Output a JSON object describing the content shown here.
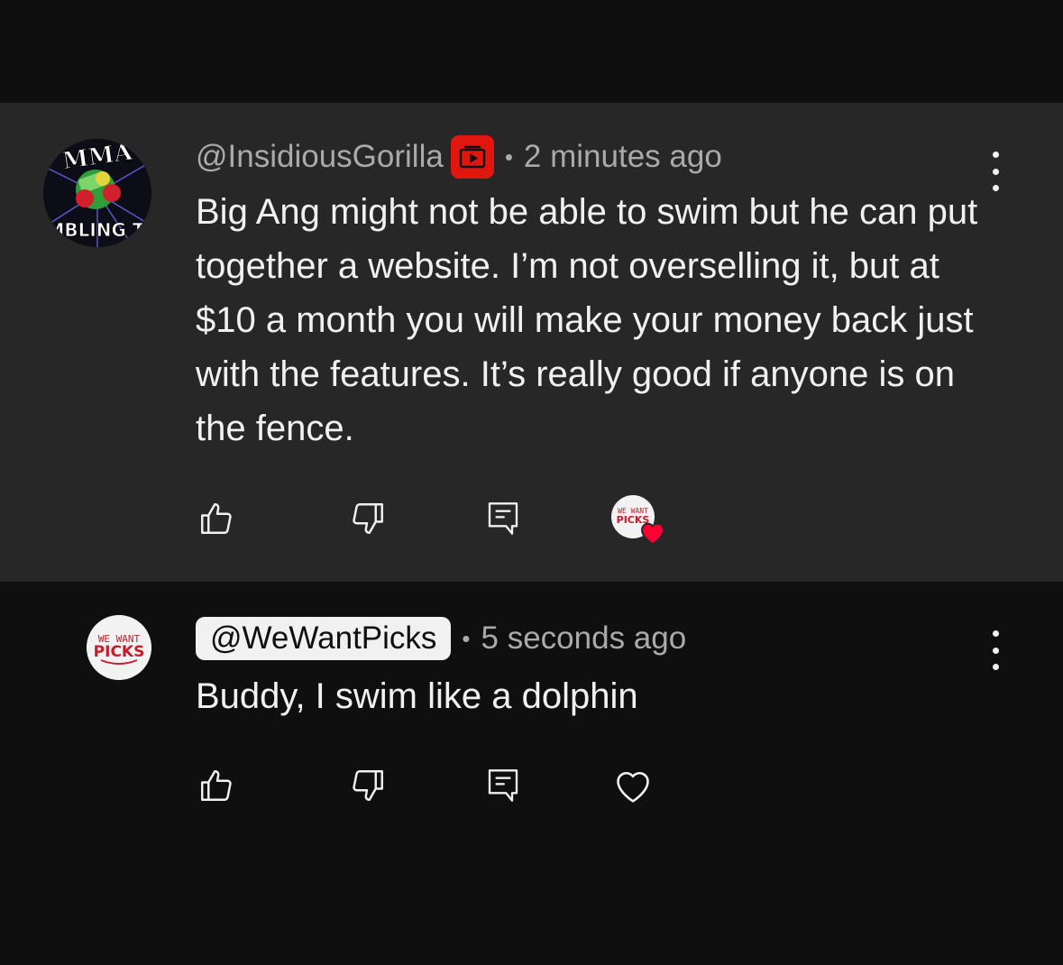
{
  "comments": [
    {
      "handle": "@InsidiousGorilla",
      "time": "2 minutes ago",
      "separator": "•",
      "text": "Big Ang might not be able to swim but he can put together a website. I’m not overselling it, but at $10 a month you will make your money back just with the features. It’s really good if anyone is on the fence.",
      "avatar_text_top": "MMA",
      "avatar_text_bottom": "MBLING T",
      "creator_hearted": true
    },
    {
      "handle": "@WeWantPicks",
      "time": "5 seconds ago",
      "separator": "•",
      "text": "Buddy, I swim like a dolphin",
      "creator_hearted": false
    }
  ],
  "logo": {
    "line1": "WE WANT",
    "line2": "PICKS"
  },
  "colors": {
    "badge": "#e1160e",
    "heart": "#ff0033",
    "panel": "#272727",
    "bg": "#0f0f0f"
  }
}
